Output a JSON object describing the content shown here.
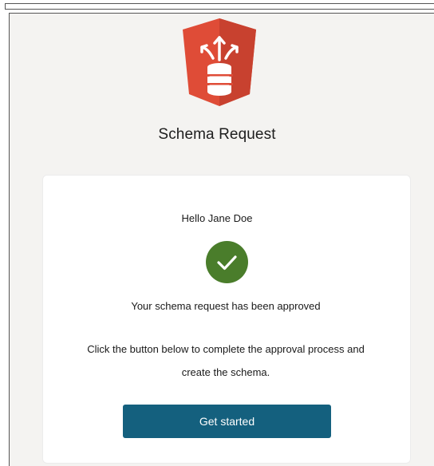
{
  "header": {
    "title": "Schema Request",
    "logo_icon": "schema-database-shield-icon"
  },
  "card": {
    "greeting": "Hello Jane Doe",
    "status_icon": "checkmark-circle-icon",
    "status_message": "Your schema request has been approved",
    "instruction_line1": "Click the button below to complete the approval process and",
    "instruction_line2": "create the schema.",
    "button_label": "Get started"
  },
  "colors": {
    "brand_red": "#dd4b36",
    "success_green": "#4a7d2b",
    "button_blue": "#14607e",
    "page_background": "#f4f3f1"
  }
}
